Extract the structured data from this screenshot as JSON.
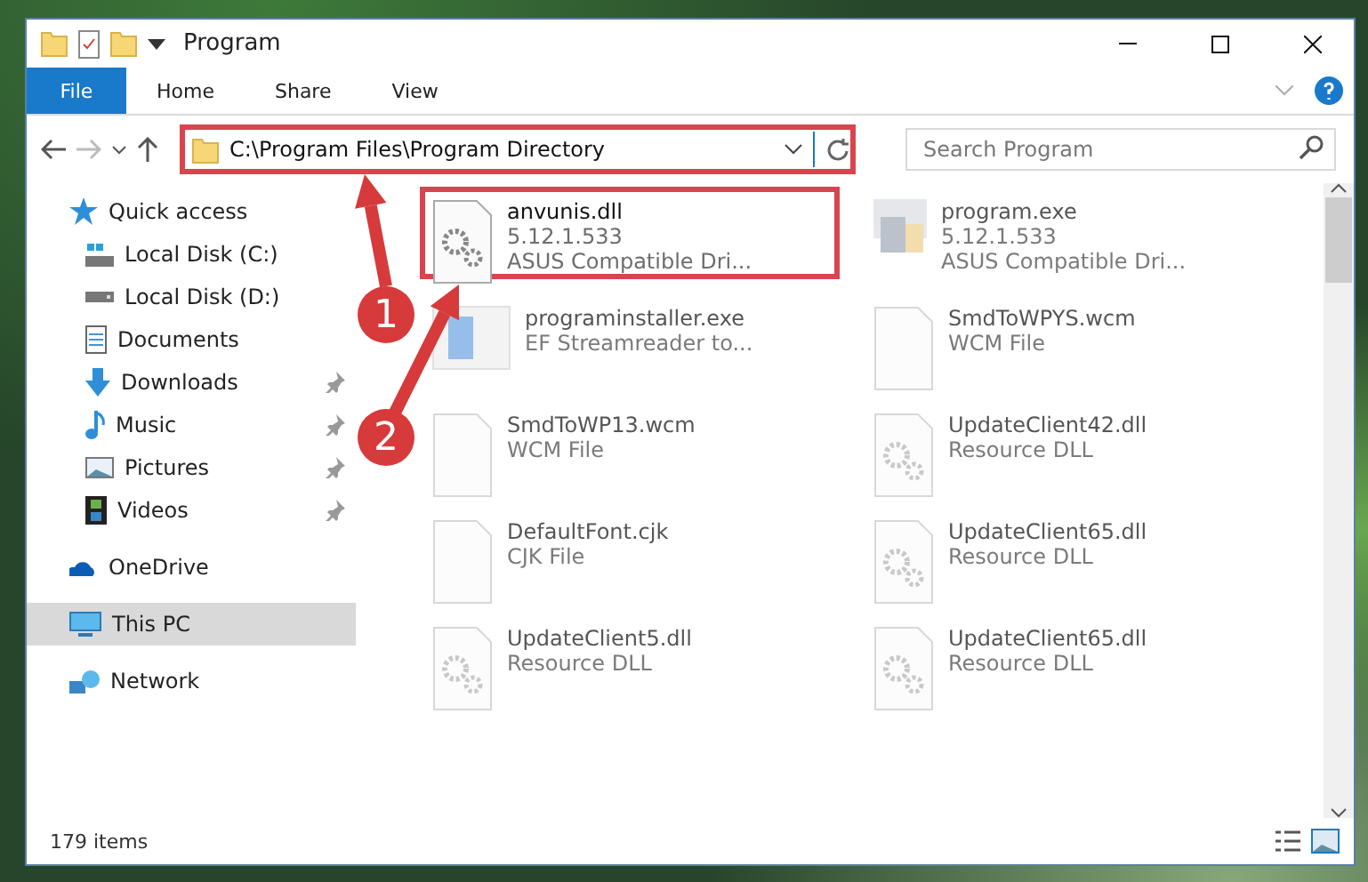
{
  "window": {
    "title": "Program"
  },
  "ribbon": {
    "tabs": [
      {
        "label": "File",
        "selected": true
      },
      {
        "label": "Home",
        "selected": false
      },
      {
        "label": "Share",
        "selected": false
      },
      {
        "label": "View",
        "selected": false
      }
    ]
  },
  "address_bar": {
    "path": "C:\\Program Files\\Program Directory",
    "highlighted": true
  },
  "search": {
    "placeholder": "Search Program"
  },
  "sidebar": {
    "items": [
      {
        "label": "Quick access",
        "kind": "star",
        "selected": false,
        "children": [
          {
            "label": "Local Disk (C:)",
            "kind": "drive-c",
            "pinned": false,
            "selected": false
          },
          {
            "label": "Local Disk (D:)",
            "kind": "drive",
            "pinned": false,
            "selected": false
          },
          {
            "label": "Documents",
            "kind": "document",
            "pinned": false,
            "selected": false
          },
          {
            "label": "Downloads",
            "kind": "download",
            "pinned": true,
            "selected": false
          },
          {
            "label": "Music",
            "kind": "music",
            "pinned": true,
            "selected": false
          },
          {
            "label": "Pictures",
            "kind": "pictures",
            "pinned": true,
            "selected": false
          },
          {
            "label": "Videos",
            "kind": "videos",
            "pinned": true,
            "selected": false
          }
        ]
      },
      {
        "label": "OneDrive",
        "kind": "cloud",
        "selected": false
      },
      {
        "label": "This PC",
        "kind": "pc",
        "selected": true
      },
      {
        "label": "Network",
        "kind": "network",
        "selected": false
      }
    ]
  },
  "files": [
    {
      "name": "anvunis.dll",
      "details": [
        "5.12.1.533",
        "ASUS Compatible Dri..."
      ],
      "kind": "settings",
      "faded": false,
      "highlighted": true
    },
    {
      "name": "program.exe",
      "details": [
        "5.12.1.533",
        "ASUS Compatible Dri..."
      ],
      "kind": "app",
      "faded": true,
      "highlighted": false
    },
    {
      "name": "programinstaller.exe",
      "details": [
        "EF Streamreader to..."
      ],
      "kind": "installer",
      "faded": true,
      "highlighted": false
    },
    {
      "name": "SmdToWPYS.wcm",
      "details": [
        "WCM File"
      ],
      "kind": "blank",
      "faded": true,
      "highlighted": false
    },
    {
      "name": "SmdToWP13.wcm",
      "details": [
        "WCM File"
      ],
      "kind": "blank",
      "faded": true,
      "highlighted": false
    },
    {
      "name": "UpdateClient42.dll",
      "details": [
        "Resource DLL"
      ],
      "kind": "settings",
      "faded": true,
      "highlighted": false
    },
    {
      "name": "DefaultFont.cjk",
      "details": [
        "CJK File"
      ],
      "kind": "blank",
      "faded": true,
      "highlighted": false
    },
    {
      "name": "UpdateClient65.dll",
      "details": [
        "Resource DLL"
      ],
      "kind": "settings",
      "faded": true,
      "highlighted": false
    },
    {
      "name": "UpdateClient5.dll",
      "details": [
        "Resource DLL"
      ],
      "kind": "settings",
      "faded": true,
      "highlighted": false
    },
    {
      "name": "UpdateClient65.dll",
      "details": [
        "Resource DLL"
      ],
      "kind": "settings",
      "faded": true,
      "highlighted": false
    }
  ],
  "status_bar": {
    "count": "179 items"
  },
  "callouts": [
    {
      "number": "1"
    },
    {
      "number": "2"
    }
  ]
}
